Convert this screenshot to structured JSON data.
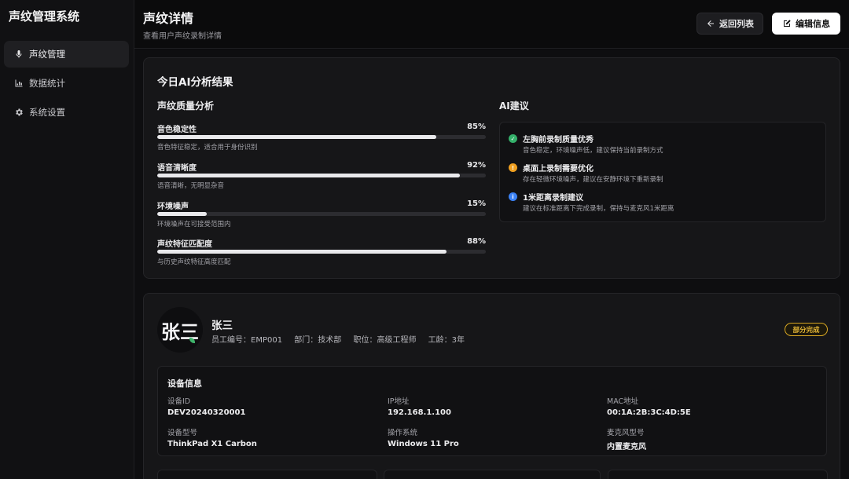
{
  "app": {
    "title": "声纹管理系统"
  },
  "sidebar": {
    "items": [
      {
        "label": "声纹管理",
        "icon": "microphone-icon",
        "active": true
      },
      {
        "label": "数据统计",
        "icon": "bar-chart-icon",
        "active": false
      },
      {
        "label": "系统设置",
        "icon": "gear-icon",
        "active": false
      }
    ]
  },
  "header": {
    "title": "声纹详情",
    "subtitle": "查看用户声纹录制详情",
    "back_label": "返回列表",
    "edit_label": "编辑信息"
  },
  "analysis": {
    "title": "今日AI分析结果",
    "quality_title": "声纹质量分析",
    "metrics": [
      {
        "name": "音色稳定性",
        "percent": 85,
        "percent_label": "85%",
        "desc": "音色特征稳定，适合用于身份识别"
      },
      {
        "name": "语音清晰度",
        "percent": 92,
        "percent_label": "92%",
        "desc": "语音清晰，无明显杂音"
      },
      {
        "name": "环境噪声",
        "percent": 15,
        "percent_label": "15%",
        "desc": "环境噪声在可接受范围内"
      },
      {
        "name": "声纹特征匹配度",
        "percent": 88,
        "percent_label": "88%",
        "desc": "与历史声纹特征高度匹配"
      }
    ],
    "advice_title": "AI建议",
    "advice": [
      {
        "title": "左胸前录制质量优秀",
        "desc": "音色稳定，环境噪声低，建议保持当前录制方式",
        "status": "success",
        "color": "#34b06a",
        "glyph": "✓"
      },
      {
        "title": "桌面上录制需要优化",
        "desc": "存在轻微环境噪声，建议在安静环境下重新录制",
        "status": "warning",
        "color": "#f0a020",
        "glyph": "!"
      },
      {
        "title": "1米距离录制建议",
        "desc": "建议在标准距离下完成录制，保持与麦克风1米距离",
        "status": "info",
        "color": "#3b82f6",
        "glyph": "i"
      }
    ]
  },
  "user": {
    "avatar_text": "张三",
    "name": "张三",
    "employee_id": "员工编号：EMP001",
    "department": "部门：技术部",
    "position": "职位：高级工程师",
    "tenure": "工龄：3年",
    "status_badge": "部分完成"
  },
  "device": {
    "title": "设备信息",
    "fields": [
      {
        "label": "设备ID",
        "value": "DEV20240320001"
      },
      {
        "label": "IP地址",
        "value": "192.168.1.100"
      },
      {
        "label": "MAC地址",
        "value": "00:1A:2B:3C:4D:5E"
      },
      {
        "label": "设备型号",
        "value": "ThinkPad X1 Carbon"
      },
      {
        "label": "操作系统",
        "value": "Windows 11 Pro"
      },
      {
        "label": "麦克风型号",
        "value": "内置麦克风"
      }
    ]
  }
}
